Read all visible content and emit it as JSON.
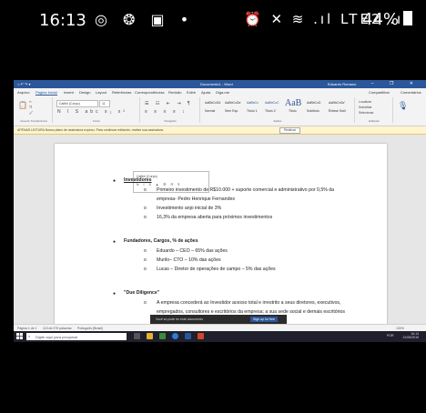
{
  "phone_status": {
    "time": "16:13",
    "left_icons": "◎ ❂ ▣ •",
    "right_icons": "⏰ ✕ ≋ .ıl LTE2 .ıl",
    "battery": "44%"
  },
  "word": {
    "title_center": "Documento1 - Word",
    "user": "Eduardo Romano",
    "tabs": [
      "Arquivo",
      "Página Inicial",
      "Inserir",
      "Design",
      "Layout",
      "Referências",
      "Correspondências",
      "Revisão",
      "Exibir",
      "Ajuda",
      "Diga-me"
    ],
    "share_label": "Compartilhar",
    "comments_label": "Comentários",
    "ribbon": {
      "groups": [
        "Área de Transferência",
        "Fonte",
        "Parágrafo",
        "Estilos",
        "Editando"
      ],
      "font_name": "Calibri (Corpo)",
      "font_size": "11",
      "styles": [
        "AaBbCcDd",
        "AaBbCcDd",
        "AaBbCc",
        "AaBbCcC",
        "AaB",
        "AaBbCcD",
        "AaBbCcDd"
      ],
      "style_names": [
        "Normal",
        "Sem Esp.",
        "Título 1",
        "Título 2",
        "Título",
        "Subtítulo",
        "Ênfase Sutil"
      ],
      "editing": [
        "Localizar",
        "Substituir",
        "Selecionar"
      ]
    },
    "infobar": {
      "message": "APENAS LEITURA  Nosso plano de assinatura expirou. Para continuar editando, reative sua assinatura.",
      "button": "Reativar"
    },
    "document": {
      "sections": [
        {
          "heading": "Investidores",
          "items": [
            "Primeiro investimento de R$10.000 + suporte comercial e administrativo por 0,5% da",
            "empresa- Pedro Henrique Fernandes",
            "Investimento anjo inicial de 3%",
            "16,3% da empresa aberta para próximos investimentos"
          ]
        },
        {
          "heading": "Fundadores, Cargos, % de ações",
          "items": [
            "Eduardo – CEO – 65% das ações",
            "Murilo– CTO – 10% das ações",
            "Lucas – Diretor de operações de campo – 5% das ações"
          ]
        },
        {
          "heading": "\"Due Diligence\"",
          "items": [
            "A empresa concederá ao Investidor acesso total e irrestrito a seus diretores, executivos,",
            "empregados, consultores e escritórios da empresa; a sua sede social e demais escritórios"
          ]
        }
      ]
    },
    "statusbar": {
      "page": "Página 1 de 1",
      "words": "119 de 270 palavras",
      "language": "Português (Brasil)",
      "zoom": "100%"
    },
    "toast": {
      "message": "Você só pode ler este documento",
      "button": "Sign up for free"
    }
  },
  "taskbar": {
    "search_placeholder": "Digite aqui para pesquisar",
    "time": "16:13",
    "date": "21/05/2019",
    "lang": "POR"
  }
}
